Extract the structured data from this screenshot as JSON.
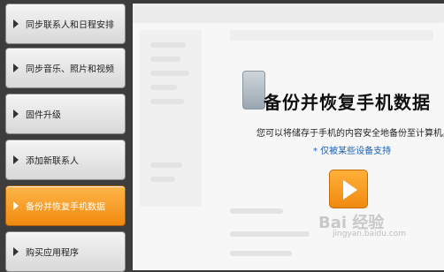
{
  "sidebar": {
    "items": [
      {
        "label": "同步联系人和日程安排",
        "active": false
      },
      {
        "label": "同步音乐、照片和视频",
        "active": false
      },
      {
        "label": "固件升级",
        "active": false
      },
      {
        "label": "添加新联系人",
        "active": false
      },
      {
        "label": "备份并恢复手机数据",
        "active": true
      },
      {
        "label": "购买应用程序",
        "active": false
      }
    ]
  },
  "main": {
    "title": "备份并恢复手机数据",
    "subtitle": "您可以将储存于手机的内容安全地备份至计算机。",
    "support_link": "* 仅被某些设备支持"
  },
  "watermark": {
    "logo_text": "Bai 经验",
    "url": "jingyan.baidu.com"
  },
  "colors": {
    "accent": "#f08a10",
    "link": "#1a5fb4"
  }
}
